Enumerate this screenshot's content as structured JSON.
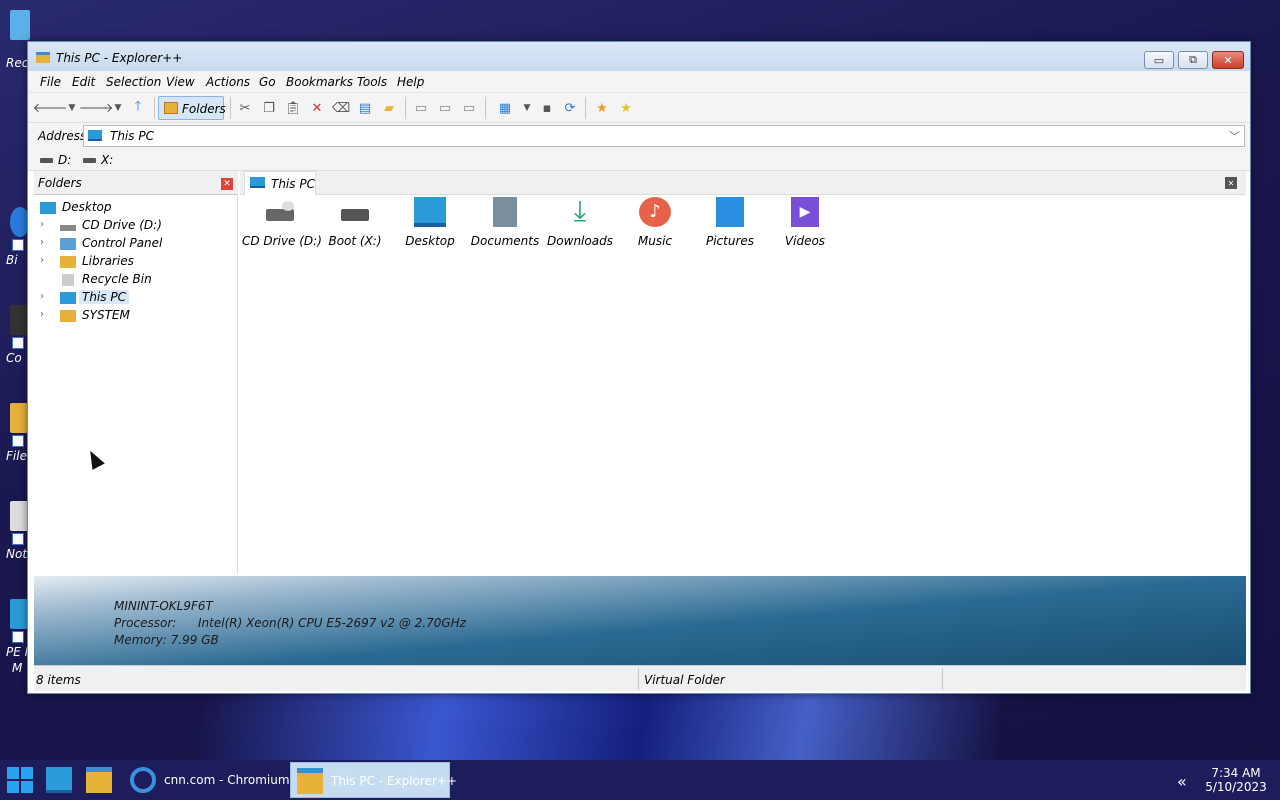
{
  "desktop": {
    "icons": [
      {
        "label": "Rec",
        "color": "#5ab0e8"
      },
      {
        "label": "Bi",
        "color": "#2a7ad8"
      },
      {
        "label": "Co",
        "color": "#333333"
      },
      {
        "label": "File",
        "color": "#e8b13a"
      },
      {
        "label": "Not",
        "color": "#dddddd"
      },
      {
        "label": "PE I",
        "label2": "M",
        "color": "#2a9bd8"
      }
    ]
  },
  "window": {
    "title": "This PC - Explorer++",
    "controls": {
      "minimize": "▭",
      "maximize": "⧉",
      "close": "✕"
    }
  },
  "menubar": [
    "File",
    "Edit",
    "Selection",
    "View",
    "Actions",
    "Go",
    "Bookmarks",
    "Tools",
    "Help"
  ],
  "toolbar": {
    "folders_label": "Folders"
  },
  "address": {
    "label": "Address",
    "value": "This PC"
  },
  "drives": [
    "D:",
    "X:"
  ],
  "folders_pane": {
    "title": "Folders",
    "tree": [
      {
        "label": "Desktop",
        "icon": "desktop-icon",
        "color": "#2a9bd8"
      },
      {
        "label": "CD Drive (D:)",
        "icon": "cd-drive-icon",
        "color": "#666666"
      },
      {
        "label": "Control Panel",
        "icon": "control-panel-icon",
        "color": "#5aa0d8"
      },
      {
        "label": "Libraries",
        "icon": "folder-icon",
        "color": "#e8b13a"
      },
      {
        "label": "Recycle Bin",
        "icon": "recycle-bin-icon",
        "color": "#cccccc"
      },
      {
        "label": "This PC",
        "icon": "this-pc-icon",
        "color": "#2a9bd8"
      },
      {
        "label": "SYSTEM",
        "icon": "folder-icon",
        "color": "#e8b13a"
      }
    ]
  },
  "content": {
    "tab_label": "This PC",
    "items": [
      {
        "label": "CD Drive (D:)",
        "icon": "cd-drive-icon",
        "color": "#666666"
      },
      {
        "label": "Boot (X:)",
        "icon": "drive-icon",
        "color": "#555555"
      },
      {
        "label": "Desktop",
        "icon": "desktop-folder-icon",
        "color": "#2a9bd8"
      },
      {
        "label": "Documents",
        "icon": "documents-icon",
        "color": "#7a8ea0"
      },
      {
        "label": "Downloads",
        "icon": "downloads-icon",
        "color": "#19a87a"
      },
      {
        "label": "Music",
        "icon": "music-icon",
        "color": "#e8624a"
      },
      {
        "label": "Pictures",
        "icon": "pictures-icon",
        "color": "#2a8fe0"
      },
      {
        "label": "Videos",
        "icon": "videos-icon",
        "color": "#7a4fd8"
      }
    ]
  },
  "info": {
    "computer_name": "MININT-OKL9F6T",
    "processor_label": "Processor:",
    "processor_value": "Intel(R) Xeon(R) CPU E5-2697 v2 @ 2.70GHz",
    "memory": "Memory: 7.99 GB"
  },
  "status": {
    "items": "8 items",
    "type": "Virtual Folder"
  },
  "taskbar": {
    "apps": [
      {
        "label": "",
        "icon": "desktop-icon"
      },
      {
        "label": "",
        "icon": "file-explorer-icon"
      },
      {
        "label": "cnn.com - Chromium",
        "icon": "chromium-icon"
      },
      {
        "label": "This PC - Explorer++",
        "icon": "explorer-plus-icon"
      }
    ],
    "time": "7:34 AM",
    "date": "5/10/2023"
  }
}
